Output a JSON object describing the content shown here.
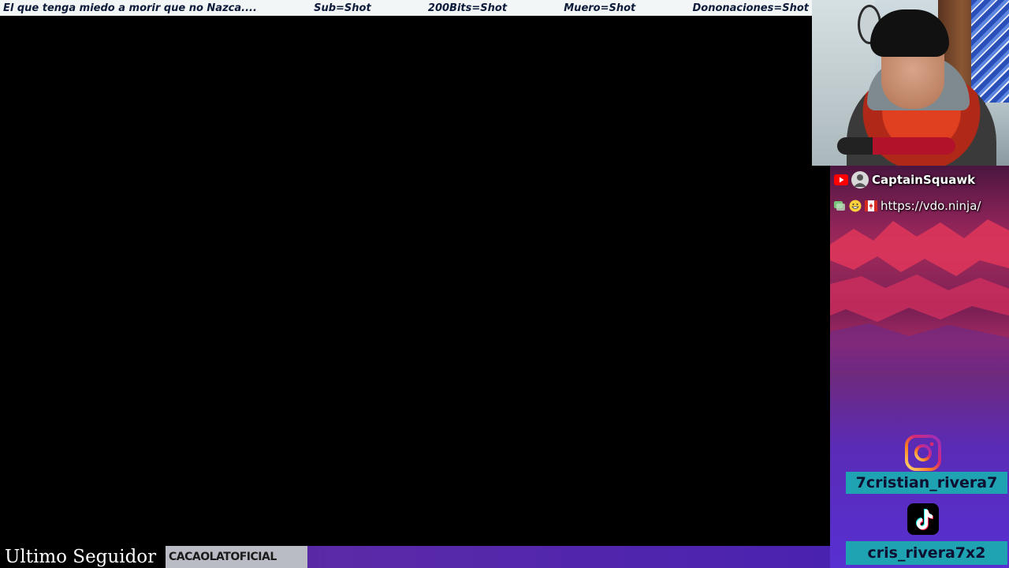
{
  "ticker": {
    "item_1": "El que tenga miedo a morir que no Nazca....",
    "item_2": "Sub=Shot",
    "item_3": "200Bits=Shot",
    "item_4": "Muero=Shot",
    "item_5": "Dononaciones=Shot"
  },
  "chat": {
    "message_1": {
      "platform_icon": "youtube-icon",
      "avatar_icon": "user-avatar-icon",
      "text": "CaptainSquawk"
    },
    "message_2": {
      "badge_icons": [
        "chat-badge-icon",
        "grin-emoji-icon",
        "canada-flag-icon"
      ],
      "text": "https://vdo.ninja/"
    }
  },
  "socials": {
    "instagram": {
      "icon": "instagram-icon",
      "handle": "7cristian_rivera7"
    },
    "tiktok": {
      "icon": "tiktok-icon",
      "handle": "cris_rivera7x2"
    }
  },
  "bottom_bar": {
    "label": "Ultimo Seguidor",
    "follower_name": "CACAOLATOFICIAL"
  },
  "colors": {
    "ticker_bg": "#f3f6f6",
    "ticker_text": "#0d1b3a",
    "handle_bg": "#1fa3b3",
    "handle_text": "#0d1030",
    "follower_name_bg": "#b9bcc4"
  }
}
